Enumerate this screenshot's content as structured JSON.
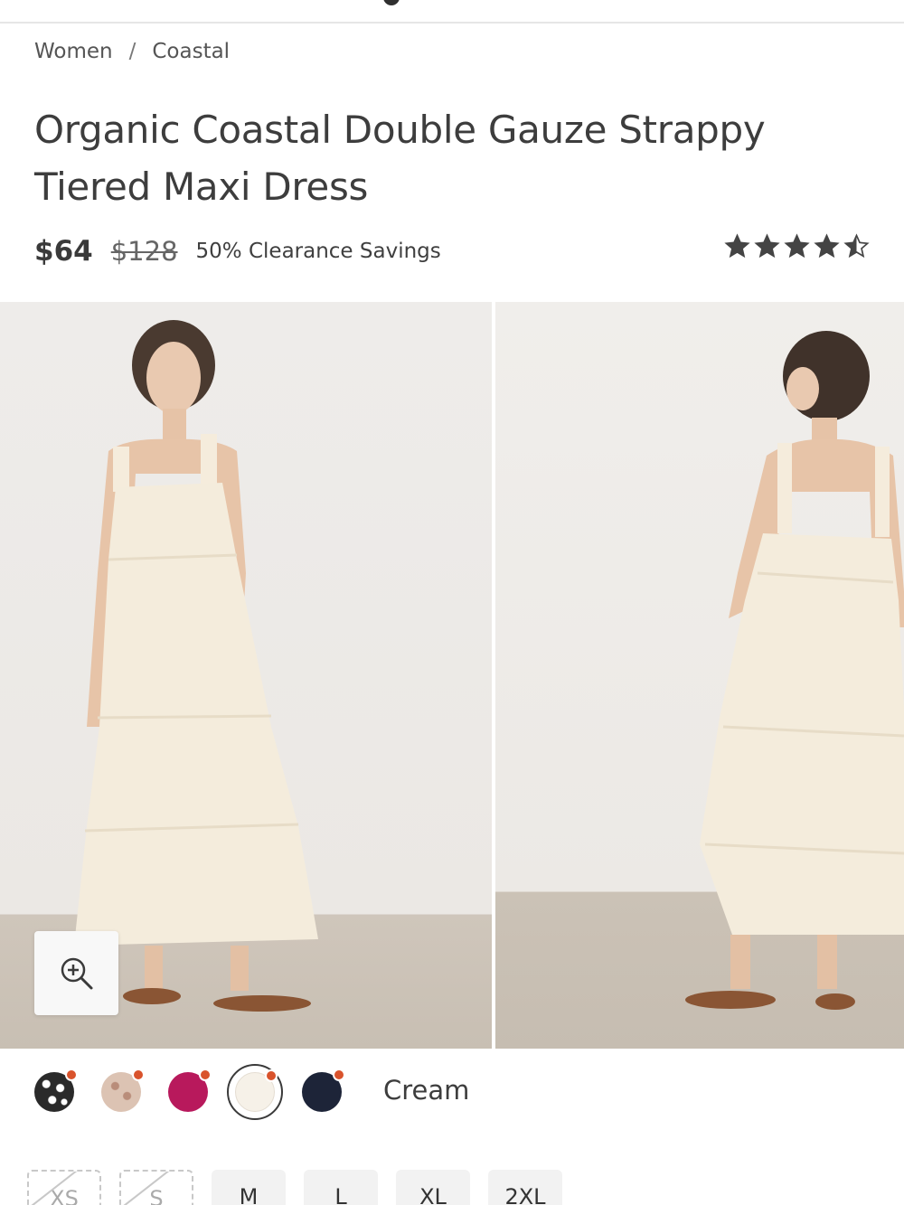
{
  "breadcrumb": {
    "items": [
      "Women",
      "Coastal"
    ],
    "separator": "/"
  },
  "product": {
    "title": "Organic Coastal Double Gauze Strappy Tiered Maxi Dress",
    "price": "$64",
    "original_price": "$128",
    "savings": "50% Clearance Savings",
    "rating": 4.5
  },
  "colors": {
    "options": [
      {
        "name": "black floral",
        "swatch": "#2a2a2a",
        "icon": "floral-pattern"
      },
      {
        "name": "blush floral",
        "swatch": "#dcc3b3",
        "icon": "floral-pattern"
      },
      {
        "name": "magenta",
        "swatch": "#b8195c"
      },
      {
        "name": "cream",
        "swatch": "#f6f1e8"
      },
      {
        "name": "navy",
        "swatch": "#1d2438"
      }
    ],
    "selected": "Cream",
    "sale_dot_color": "#d9532c"
  },
  "sizes": [
    {
      "label": "XS",
      "available": false
    },
    {
      "label": "S",
      "available": false
    },
    {
      "label": "M",
      "available": true
    },
    {
      "label": "L",
      "available": true
    },
    {
      "label": "XL",
      "available": true
    },
    {
      "label": "2XL",
      "available": true
    }
  ],
  "icons": {
    "zoom": "zoom-in-icon",
    "rating": "star-icon"
  }
}
